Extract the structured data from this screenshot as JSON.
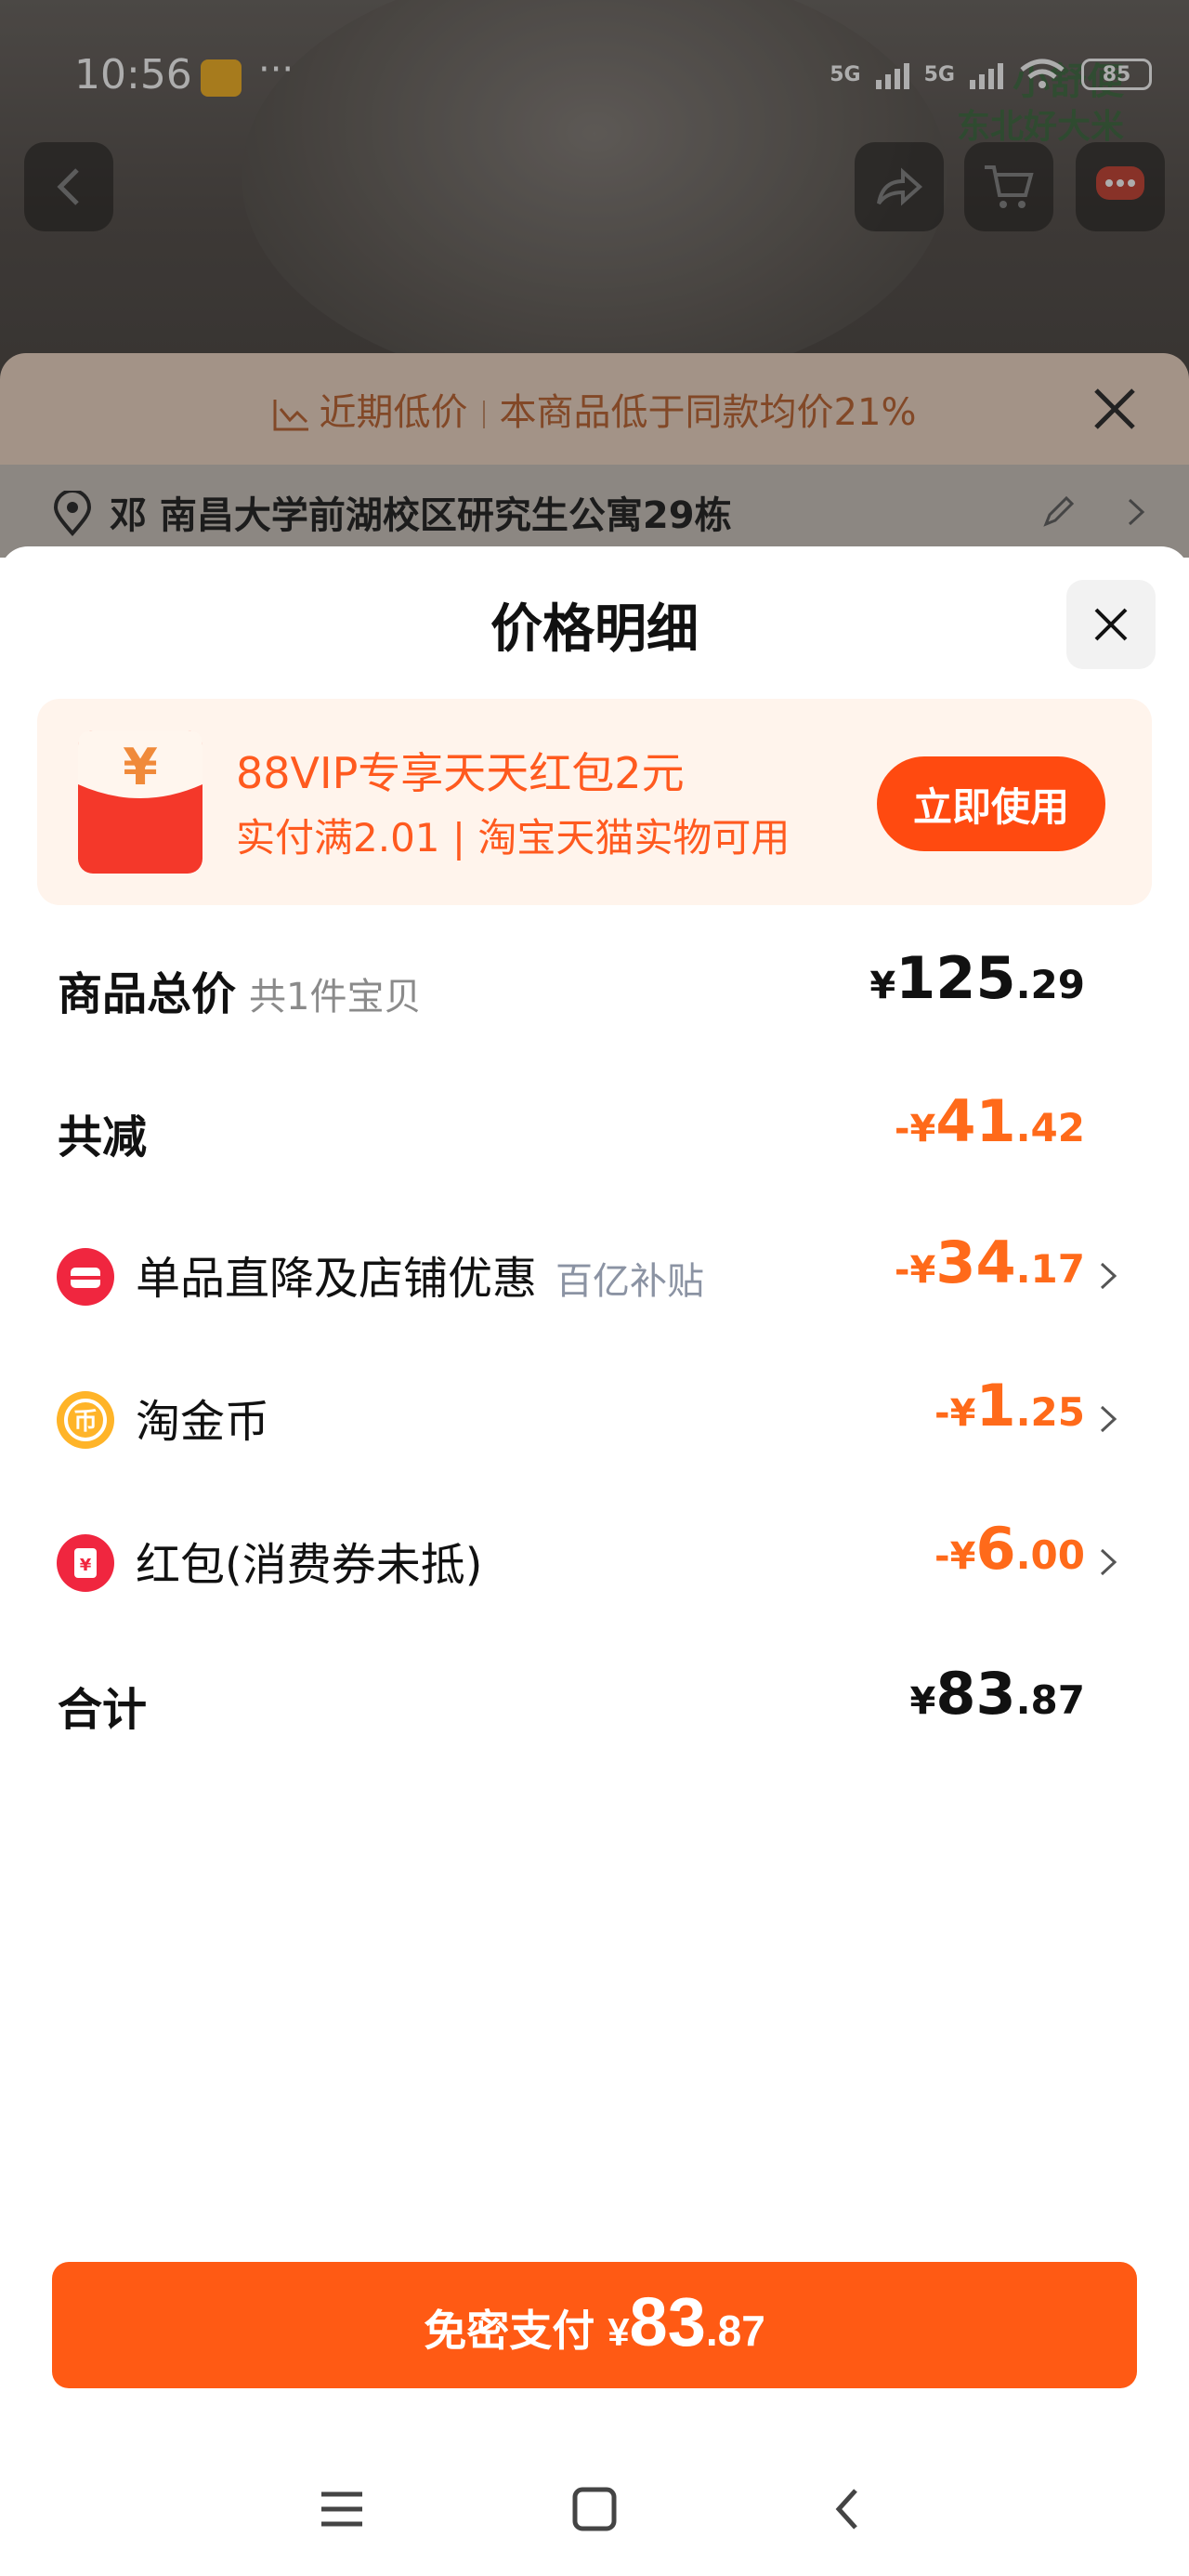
{
  "status_bar": {
    "time": "10:56",
    "dots": "···",
    "sig1": "5G",
    "sig2": "5G",
    "battery": "85"
  },
  "brand_watermark": {
    "line1": "小舒便",
    "line2": "东北好大米"
  },
  "promo_strip": {
    "prefix": "近期低价",
    "text": "本商品低于同款均价21%"
  },
  "address": {
    "text": "邓 南昌大学前湖校区研究生公寓29栋"
  },
  "sheet": {
    "title": "价格明细",
    "vip": {
      "title": "88VIP专享天天红包2元",
      "subtitle": "实付满2.01 | 淘宝天猫实物可用",
      "button": "立即使用"
    },
    "rows": {
      "total": {
        "label": "商品总价",
        "note": "共1件宝贝",
        "prefix": "¥",
        "int": "125",
        "dec": ".29"
      },
      "reduce": {
        "label": "共减",
        "prefix": "-¥",
        "int": "41",
        "dec": ".42"
      },
      "discount": {
        "label": "单品直降及店铺优惠",
        "sub": "百亿补贴",
        "prefix": "-¥",
        "int": "34",
        "dec": ".17"
      },
      "coins": {
        "label": "淘金币",
        "prefix": "-¥",
        "int": "1",
        "dec": ".25"
      },
      "redpacket": {
        "label": "红包(消费券未抵)",
        "prefix": "-¥",
        "int": "6",
        "dec": ".00"
      },
      "sum": {
        "label": "合计",
        "prefix": "¥",
        "int": "83",
        "dec": ".87"
      }
    },
    "pay": {
      "label": "免密支付",
      "prefix": "¥",
      "int": "83",
      "dec": ".87"
    }
  },
  "colors": {
    "accent": "#ff5a14",
    "discount": "#ff6a1a",
    "vip_bg": "#fff4ec"
  },
  "icons": [
    "back-icon",
    "share-icon",
    "cart-icon",
    "message-icon",
    "trend-icon",
    "close-icon",
    "location-icon",
    "edit-icon",
    "red-envelope-icon",
    "store-icon",
    "coin-icon",
    "coupon-icon",
    "chevron-right-icon",
    "menu-icon",
    "home-icon",
    "nav-back-icon"
  ]
}
